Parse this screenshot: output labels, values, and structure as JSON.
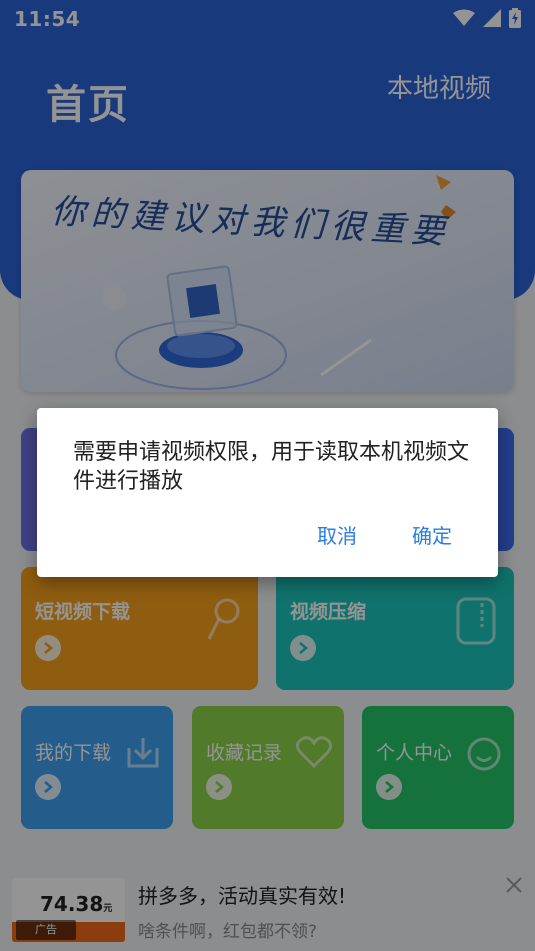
{
  "status_bar": {
    "time": "11:54"
  },
  "header": {
    "title": "首页",
    "local_video_label": "本地视频"
  },
  "banner": {
    "text": "你的建议对我们很重要"
  },
  "features": {
    "short_video_download": "短视频下载",
    "video_compress": "视频压缩",
    "my_downloads": "我的下载",
    "favorites": "收藏记录",
    "personal_center": "个人中心"
  },
  "ad": {
    "price": "74.38",
    "price_unit": "元",
    "badge": "广告",
    "title": "拼多多，活动真实有效!",
    "subtitle": "啥条件啊，红包都不领?"
  },
  "dialog": {
    "message": "需要申请视频权限，用于读取本机视频文件进行播放",
    "cancel_label": "取消",
    "confirm_label": "确定"
  },
  "colors": {
    "header_blue": "#2a62d6",
    "dialog_button": "#2a7de1",
    "card_orange": "#f6a01d",
    "card_teal": "#1cc4bb",
    "card_blue": "#3ea0f2",
    "card_lime": "#8ed24a",
    "card_green": "#27c46a"
  }
}
